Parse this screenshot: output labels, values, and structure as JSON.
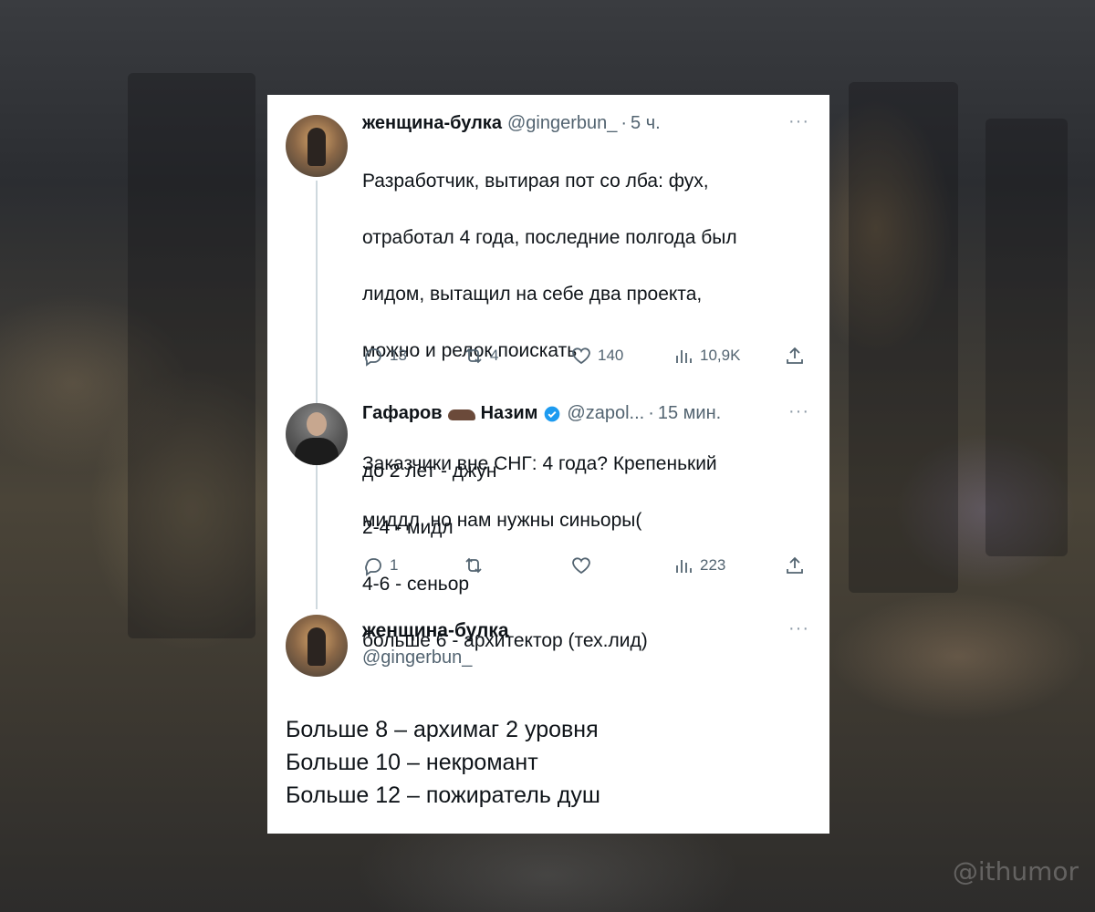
{
  "tweets": [
    {
      "name": "женщина-булка",
      "handle": "@gingerbun_",
      "dot": "·",
      "time": "5 ч.",
      "more": "···",
      "lines": [
        "Разработчик, вытирая пот со лба: фух,",
        "отработал 4 года, последние полгода был",
        "лидом, вытащил на себе два проекта,",
        "можно и релок поискать",
        "",
        "Заказчики вне СНГ: 4 года? Крепенький",
        "миддл, но нам нужны синьоры("
      ],
      "stats": {
        "replies": "13",
        "reposts": "4",
        "likes": "140",
        "views": "10,9K"
      }
    },
    {
      "name_first": "Гафаров",
      "name_last": "Назим",
      "handle": "@zapol...",
      "dot": "·",
      "time": "15 мин.",
      "more": "···",
      "lines": [
        "до 2 лет - джун",
        "2-4 - мидл",
        "4-6 - сеньор",
        "больше 6 - архитектор (тех.лид)"
      ],
      "stats": {
        "replies": "1",
        "reposts": "",
        "likes": "",
        "views": "223"
      }
    },
    {
      "name": "женщина-булка",
      "handle": "@gingerbun_",
      "more": "···",
      "lines": [
        "Больше 8 – архимаг 2 уровня",
        "Больше 10 – некромант",
        "Больше 12 – пожиратель душ"
      ]
    }
  ],
  "icons": [
    "reply-icon",
    "repost-icon",
    "like-icon",
    "views-icon",
    "share-icon",
    "verified-badge-icon",
    "more-icon"
  ],
  "colors": {
    "text": "#0f1419",
    "muted": "#536471",
    "verified": "#1d9bf0",
    "card_bg": "#ffffff"
  },
  "watermark": "@ithumor"
}
